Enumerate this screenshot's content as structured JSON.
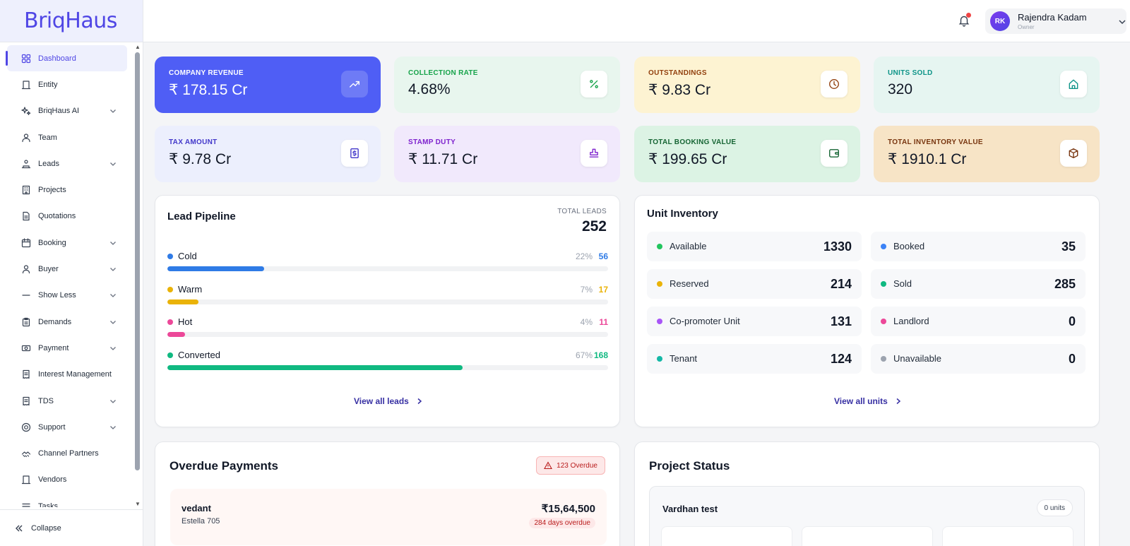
{
  "brand": {
    "logo": "BriqHaus",
    "color": "#4f46e5"
  },
  "header": {
    "notification_icon": "bell-icon",
    "user": {
      "initials": "RK",
      "name": "Rajendra Kadam",
      "role": "Owner"
    }
  },
  "sidebar": {
    "items": [
      {
        "label": "Dashboard",
        "icon": "grid-icon",
        "expandable": false,
        "active": true
      },
      {
        "label": "Entity",
        "icon": "building-icon",
        "expandable": false
      },
      {
        "label": "BriqHaus AI",
        "icon": "sparkles-icon",
        "expandable": true
      },
      {
        "label": "Team",
        "icon": "users-icon",
        "expandable": false
      },
      {
        "label": "Leads",
        "icon": "leads-icon",
        "expandable": true
      },
      {
        "label": "Projects",
        "icon": "office-icon",
        "expandable": false
      },
      {
        "label": "Quotations",
        "icon": "document-icon",
        "expandable": false
      },
      {
        "label": "Booking",
        "icon": "calendar-icon",
        "expandable": true
      },
      {
        "label": "Buyer",
        "icon": "user-icon",
        "expandable": true
      },
      {
        "label": "Show Less",
        "icon": "minus-icon",
        "expandable": true
      },
      {
        "label": "Demands",
        "icon": "clipboard-icon",
        "expandable": true
      },
      {
        "label": "Payment",
        "icon": "money-icon",
        "expandable": true
      },
      {
        "label": "Interest Management",
        "icon": "receipt-icon",
        "expandable": false
      },
      {
        "label": "TDS",
        "icon": "receipt-icon",
        "expandable": true
      },
      {
        "label": "Support",
        "icon": "lifebuoy-icon",
        "expandable": true
      },
      {
        "label": "Channel Partners",
        "icon": "partners-icon",
        "expandable": false
      },
      {
        "label": "Vendors",
        "icon": "building-icon",
        "expandable": false
      },
      {
        "label": "Tasks",
        "icon": "tasks-icon",
        "expandable": false
      }
    ],
    "collapse_label": "Collapse"
  },
  "stats": [
    {
      "label": "COMPANY REVENUE",
      "value": "₹ 178.15 Cr",
      "icon": "trending-up-icon",
      "bg": "#4f5ef5",
      "label_color": "#ffffff",
      "value_color": "#ffffff"
    },
    {
      "label": "COLLECTION RATE",
      "value": "4.68%",
      "icon": "percent-icon",
      "bg": "#e8f6ee",
      "label_color": "#16a34a",
      "value_color": "#111827"
    },
    {
      "label": "OUTSTANDINGS",
      "value": "₹ 9.83 Cr",
      "icon": "clock-icon",
      "bg": "#fdf3d2",
      "label_color": "#92400e",
      "value_color": "#111827"
    },
    {
      "label": "UNITS SOLD",
      "value": "320",
      "icon": "home-icon",
      "bg": "#e6f5f1",
      "label_color": "#0d9488",
      "value_color": "#111827"
    },
    {
      "label": "TAX AMOUNT",
      "value": "₹ 9.78 Cr",
      "icon": "tax-icon",
      "bg": "#eceffd",
      "label_color": "#4338ca",
      "value_color": "#111827"
    },
    {
      "label": "STAMP DUTY",
      "value": "₹ 11.71 Cr",
      "icon": "stamp-icon",
      "bg": "#f1e9fc",
      "label_color": "#7e22ce",
      "value_color": "#111827"
    },
    {
      "label": "TOTAL BOOKING VALUE",
      "value": "₹ 199.65 Cr",
      "icon": "wallet-icon",
      "bg": "#dcf3e4",
      "label_color": "#166534",
      "value_color": "#111827"
    },
    {
      "label": "TOTAL INVENTORY VALUE",
      "value": "₹ 1910.1 Cr",
      "icon": "box-icon",
      "bg": "#f7e4c6",
      "label_color": "#78350f",
      "value_color": "#111827"
    }
  ],
  "lead_pipeline": {
    "title": "Lead Pipeline",
    "total_label": "TOTAL LEADS",
    "total": "252",
    "rows": [
      {
        "name": "Cold",
        "pct": "22%",
        "count": "56",
        "fraction": 0.22,
        "color": "#2f7be6"
      },
      {
        "name": "Warm",
        "pct": "7%",
        "count": "17",
        "fraction": 0.07,
        "color": "#eab308"
      },
      {
        "name": "Hot",
        "pct": "4%",
        "count": "11",
        "fraction": 0.04,
        "color": "#ec4899"
      },
      {
        "name": "Converted",
        "pct": "67%",
        "count": "168",
        "fraction": 0.67,
        "color": "#10b981"
      }
    ],
    "link": "View all leads"
  },
  "unit_inventory": {
    "title": "Unit Inventory",
    "cells": [
      {
        "name": "Available",
        "value": "1330",
        "color": "#22c55e"
      },
      {
        "name": "Booked",
        "value": "35",
        "color": "#3b82f6"
      },
      {
        "name": "Reserved",
        "value": "214",
        "color": "#eab308"
      },
      {
        "name": "Sold",
        "value": "285",
        "color": "#10b981"
      },
      {
        "name": "Co-promoter Unit",
        "value": "131",
        "color": "#a855f7"
      },
      {
        "name": "Landlord",
        "value": "0",
        "color": "#ec4899"
      },
      {
        "name": "Tenant",
        "value": "124",
        "color": "#14b8a6"
      },
      {
        "name": "Unavailable",
        "value": "0",
        "color": "#9ca3af"
      }
    ],
    "link": "View all units"
  },
  "overdue_payments": {
    "title": "Overdue Payments",
    "badge": "123 Overdue",
    "items": [
      {
        "name": "vedant",
        "unit": "Estella 705",
        "amount": "₹15,64,500",
        "days": "284 days overdue"
      }
    ]
  },
  "project_status": {
    "title": "Project Status",
    "projects": [
      {
        "name": "Vardhan test",
        "units": "0 units"
      }
    ]
  }
}
